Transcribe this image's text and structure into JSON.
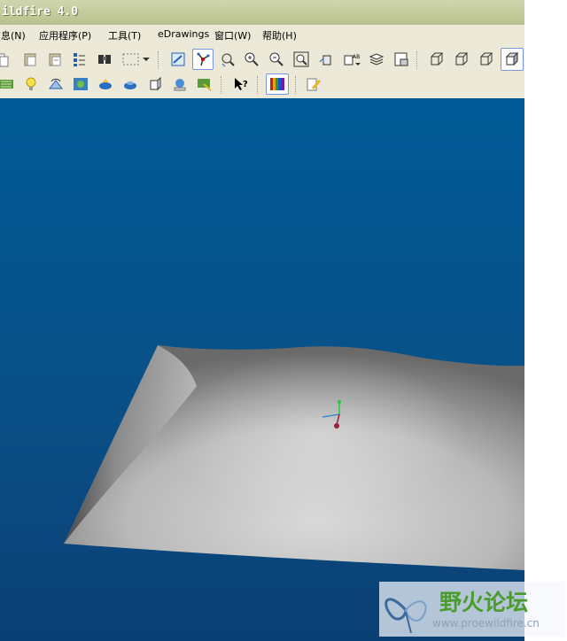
{
  "window": {
    "title": "ildfire 4.0"
  },
  "menu": [
    {
      "label": "信息(N)"
    },
    {
      "label": "应用程序(P)"
    },
    {
      "label": "工具(T)"
    },
    {
      "label": "eDrawings"
    },
    {
      "label": "窗口(W)"
    },
    {
      "label": "帮助(H)"
    }
  ],
  "toolbar_icons": {
    "row1": [
      "copy-icon",
      "paste-icon",
      "paste-special-icon",
      "regenerate-icon",
      "find-icon",
      "select-box-icon",
      "dropdown-arrow-icon",
      "repaint-icon",
      "spin-center-icon",
      "orient-mode-icon",
      "zoom-in-icon",
      "zoom-out-icon",
      "refit-icon",
      "reorient-icon",
      "saved-views-icon",
      "layers-icon",
      "model-tree-icon",
      "wireframe-icon",
      "hidden-line-icon",
      "no-hidden-icon",
      "shading-icon"
    ],
    "row2": [
      "datum-planes-icon",
      "light-bulb-icon",
      "spin-view-icon",
      "appearance-icon",
      "render-icon",
      "teapot-icon",
      "model-setup-icon",
      "sphere-render-icon",
      "measure-icon",
      "context-help-icon",
      "color-palette-icon",
      "edit-note-icon"
    ]
  },
  "watermark": {
    "text": "野火论坛",
    "url": "www.proewildfire.cn"
  },
  "colors": {
    "viewport_top": "#005a96",
    "viewport_bottom": "#0a3f73",
    "toolbar_bg": "#ece9d8",
    "title_bg": "#c5cc9e"
  }
}
